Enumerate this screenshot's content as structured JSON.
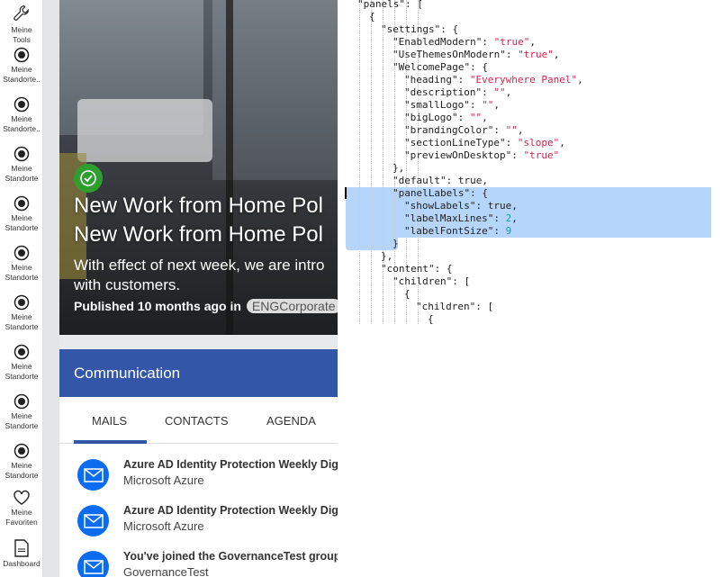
{
  "sidebar": {
    "items": [
      {
        "label": "Meine Tools",
        "icon": "wrench-icon"
      },
      {
        "label": "Meine Standorte..",
        "icon": "radio-icon"
      },
      {
        "label": "Meine Standorte..",
        "icon": "radio-icon"
      },
      {
        "label": "Meine Standorte",
        "icon": "radio-icon"
      },
      {
        "label": "Meine Standorte",
        "icon": "radio-icon"
      },
      {
        "label": "Meine Standorte",
        "icon": "radio-icon"
      },
      {
        "label": "Meine Standorte",
        "icon": "radio-icon"
      },
      {
        "label": "Meine Standorte",
        "icon": "radio-icon"
      },
      {
        "label": "Meine Standorte",
        "icon": "radio-icon"
      },
      {
        "label": "Meine Standorte",
        "icon": "radio-icon"
      },
      {
        "label": "Meine Favoriten",
        "icon": "heart-icon"
      },
      {
        "label": "Dashboard",
        "icon": "document-icon"
      }
    ]
  },
  "hero": {
    "title1": "New Work from Home Pol",
    "title2": "New Work from Home Pol",
    "desc1": "With effect of next week, we are intro",
    "desc2": "with customers.",
    "published": "Published 10 months ago in",
    "tag": "ENGCorporate"
  },
  "communication": {
    "title": "Communication",
    "tabs": [
      "MAILS",
      "CONTACTS",
      "AGENDA"
    ],
    "active_tab": "MAILS",
    "mails": [
      {
        "subject": "Azure AD Identity Protection Weekly Dig",
        "sender": "Microsoft Azure"
      },
      {
        "subject": "Azure AD Identity Protection Weekly Dig",
        "sender": "Microsoft Azure"
      },
      {
        "subject": "You've joined the GovernanceTest group",
        "sender": "GovernanceTest"
      }
    ],
    "accent": "#3456a8"
  },
  "code": {
    "lines": [
      {
        "i": 0,
        "k": "\"panels\": ["
      },
      {
        "i": 1,
        "k": "{"
      },
      {
        "i": 2,
        "k": "\"settings\": {"
      },
      {
        "i": 3,
        "k": "\"EnabledModern\": ",
        "v": "\"true\"",
        "t": "str",
        "e": ","
      },
      {
        "i": 3,
        "k": "\"UseThemesOnModern\": ",
        "v": "\"true\"",
        "t": "str",
        "e": ","
      },
      {
        "i": 3,
        "k": "\"WelcomePage\": {"
      },
      {
        "i": 4,
        "k": "\"heading\": ",
        "v": "\"Everywhere Panel\"",
        "t": "str",
        "e": ","
      },
      {
        "i": 4,
        "k": "\"description\": ",
        "v": "\"\"",
        "t": "str",
        "e": ","
      },
      {
        "i": 4,
        "k": "\"smallLogo\": ",
        "v": "\"\"",
        "t": "str",
        "e": ","
      },
      {
        "i": 4,
        "k": "\"bigLogo\": ",
        "v": "\"\"",
        "t": "str",
        "e": ","
      },
      {
        "i": 4,
        "k": "\"brandingColor\": ",
        "v": "\"\"",
        "t": "str",
        "e": ","
      },
      {
        "i": 4,
        "k": "\"sectionLineType\": ",
        "v": "\"slope\"",
        "t": "str",
        "e": ","
      },
      {
        "i": 4,
        "k": "\"previewOnDesktop\": ",
        "v": "\"true\"",
        "t": "str"
      },
      {
        "i": 3,
        "k": "},"
      },
      {
        "i": 3,
        "k": "\"default\": true,"
      },
      {
        "i": 3,
        "k": "\"panelLabels\": {"
      },
      {
        "i": 4,
        "k": "\"showLabels\": true,"
      },
      {
        "i": 4,
        "k": "\"labelMaxLines\": ",
        "v": "2",
        "t": "num",
        "e": ","
      },
      {
        "i": 4,
        "k": "\"labelFontSize\": ",
        "v": "9",
        "t": "num"
      },
      {
        "i": 3,
        "k": "}"
      },
      {
        "i": 2,
        "k": "},"
      },
      {
        "i": 2,
        "k": "\"content\": {"
      },
      {
        "i": 3,
        "k": "\"children\": ["
      },
      {
        "i": 4,
        "k": "{"
      },
      {
        "i": 5,
        "k": "\"children\": ["
      },
      {
        "i": 6,
        "k": "{"
      }
    ],
    "selection_lines": [
      15,
      19
    ]
  }
}
